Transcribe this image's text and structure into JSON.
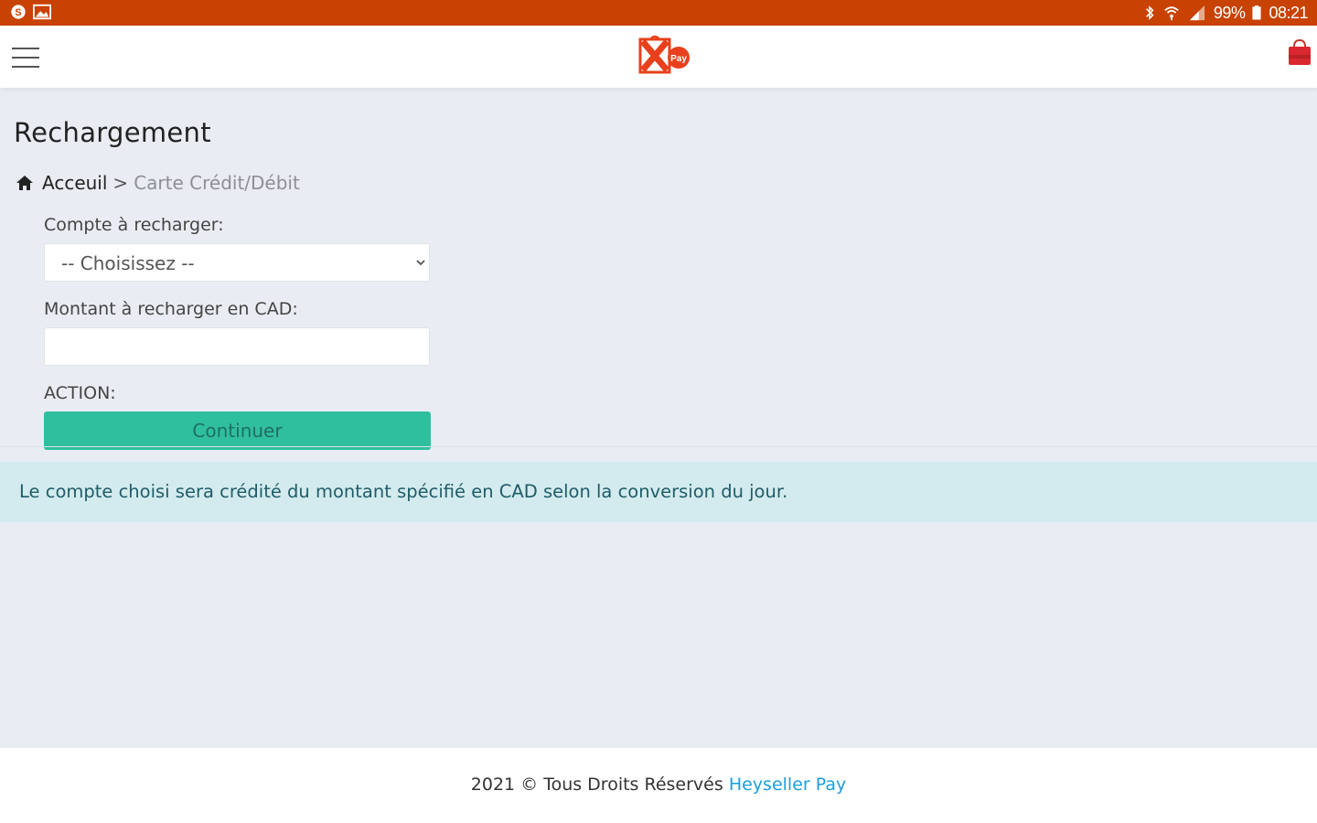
{
  "statusbar": {
    "battery": "99%",
    "time": "08:21",
    "left_icons": [
      "skype-icon",
      "image-icon"
    ],
    "right_icons": [
      "bluetooth-icon",
      "wifi-icon",
      "signal-icon",
      "battery-icon"
    ]
  },
  "header": {
    "menu_icon": "hamburger-menu-icon",
    "logo_icon": "heyseller-pay-logo",
    "cart_icon": "shopping-bag-icon"
  },
  "page": {
    "title": "Rechargement",
    "breadcrumb": {
      "home": "Acceuil",
      "separator": ">",
      "current": "Carte Crédit/Débit"
    }
  },
  "form": {
    "account_label": "Compte à recharger:",
    "account_select_value": "-- Choisissez --",
    "amount_label": "Montant à recharger en CAD:",
    "amount_value": "",
    "action_label": "ACTION:",
    "continue_label": "Continuer"
  },
  "info": {
    "message": "Le compte choisi sera crédité du montant spécifié en CAD selon la conversion du jour."
  },
  "footer": {
    "copyright": "2021 © Tous Droits Réservés",
    "brand_link": "Heyseller Pay"
  },
  "colors": {
    "statusbar": "#c84204",
    "accent_button": "#2fbf9e",
    "info_bg": "#d3ebee",
    "link": "#1a9fe0",
    "page_bg": "#e9edf3"
  }
}
